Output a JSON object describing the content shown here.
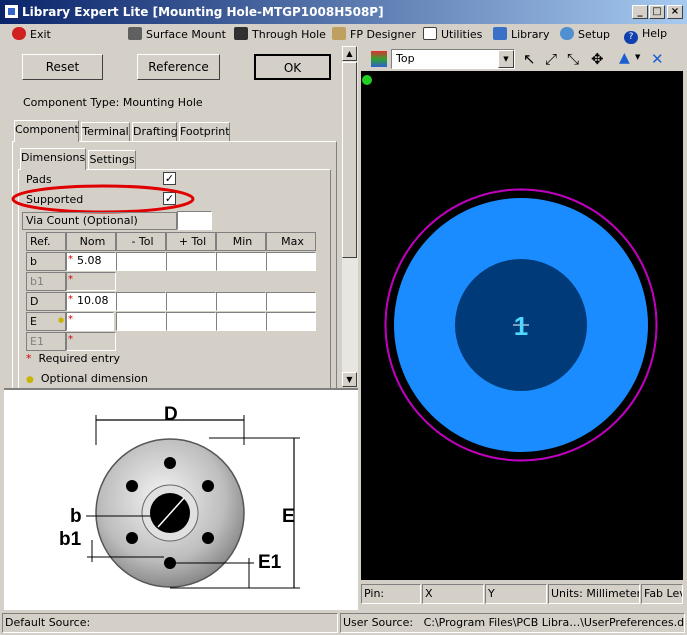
{
  "window": {
    "title": "Library Expert Lite [Mounting Hole-MTGP1008H508P]"
  },
  "menu": {
    "exit": "Exit",
    "surface_mount": "Surface Mount",
    "through_hole": "Through Hole",
    "fp_designer": "FP Designer",
    "utilities": "Utilities",
    "library": "Library",
    "setup": "Setup",
    "help": "Help"
  },
  "buttons": {
    "reset": "Reset",
    "reference": "Reference",
    "ok": "OK"
  },
  "component_type": "Component Type: Mounting Hole",
  "tabs": [
    "Component",
    "Terminal",
    "Drafting",
    "Footprint"
  ],
  "subtabs": [
    "Dimensions",
    "Settings"
  ],
  "fields": {
    "pads": "Pads",
    "supported": "Supported",
    "via_count": "Via Count (Optional)",
    "pads_checked": "✓",
    "supported_checked": "✓"
  },
  "table": {
    "headers": [
      "Ref.",
      "Nom",
      "- Tol",
      "+ Tol",
      "Min",
      "Max"
    ],
    "rows": [
      {
        "ref": "b",
        "nom": "5.08"
      },
      {
        "ref": "b1",
        "nom": ""
      },
      {
        "ref": "D",
        "nom": "10.08"
      },
      {
        "ref": "E",
        "nom": ""
      },
      {
        "ref": "E1",
        "nom": ""
      }
    ]
  },
  "legend": {
    "required": "Required entry",
    "optional": "Optional dimension"
  },
  "diagram": {
    "D": "D",
    "E": "E",
    "b": "b",
    "b1": "b1",
    "E1": "E1"
  },
  "view": {
    "layer": "Top"
  },
  "canvas": {
    "pin_label": "1"
  },
  "status_right": {
    "pin": "Pin:",
    "x": "X",
    "y": "Y",
    "units": "Units: Millimeters",
    "fab": "Fab Lev"
  },
  "statusbar": {
    "default_source": "Default Source:",
    "user_source": "User Source:",
    "path": "C:\\Program Files\\PCB Libra…\\UserPreferences.dat"
  },
  "colors": {
    "pad_outer": "#1a8cff",
    "pad_inner": "#003a78",
    "courtyard": "#cc00cc",
    "canvas_bg": "#000000",
    "highlight": "#e00000"
  }
}
